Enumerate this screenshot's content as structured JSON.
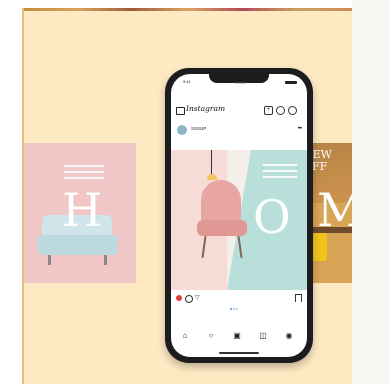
{
  "phone_screen": {
    "status_time": "9:41",
    "status_url": "●●●●●",
    "app_logo": "Instagram",
    "post": {
      "username": "SSSUP",
      "subline": "",
      "letter_center": "O"
    },
    "icons": {
      "camera": "camera-icon",
      "add": "add-icon",
      "heart": "heart-icon",
      "message": "message-icon",
      "more": "more-icon",
      "home": "home-icon",
      "search": "search-icon",
      "reels": "reels-icon",
      "shop": "shop-icon",
      "profile": "profile-icon"
    },
    "likes": ""
  },
  "carousel": {
    "left_letter": "H",
    "right_letter": "M",
    "right_title": "NEW OFF"
  },
  "colors": {
    "background": "#fde9c2",
    "pink_panel": "#f0c7c6",
    "teal_panel": "#b9dfda",
    "ochre_panel": "#d8a456",
    "phone_frame": "#1c1c1e",
    "like_red": "#e23b3b"
  }
}
